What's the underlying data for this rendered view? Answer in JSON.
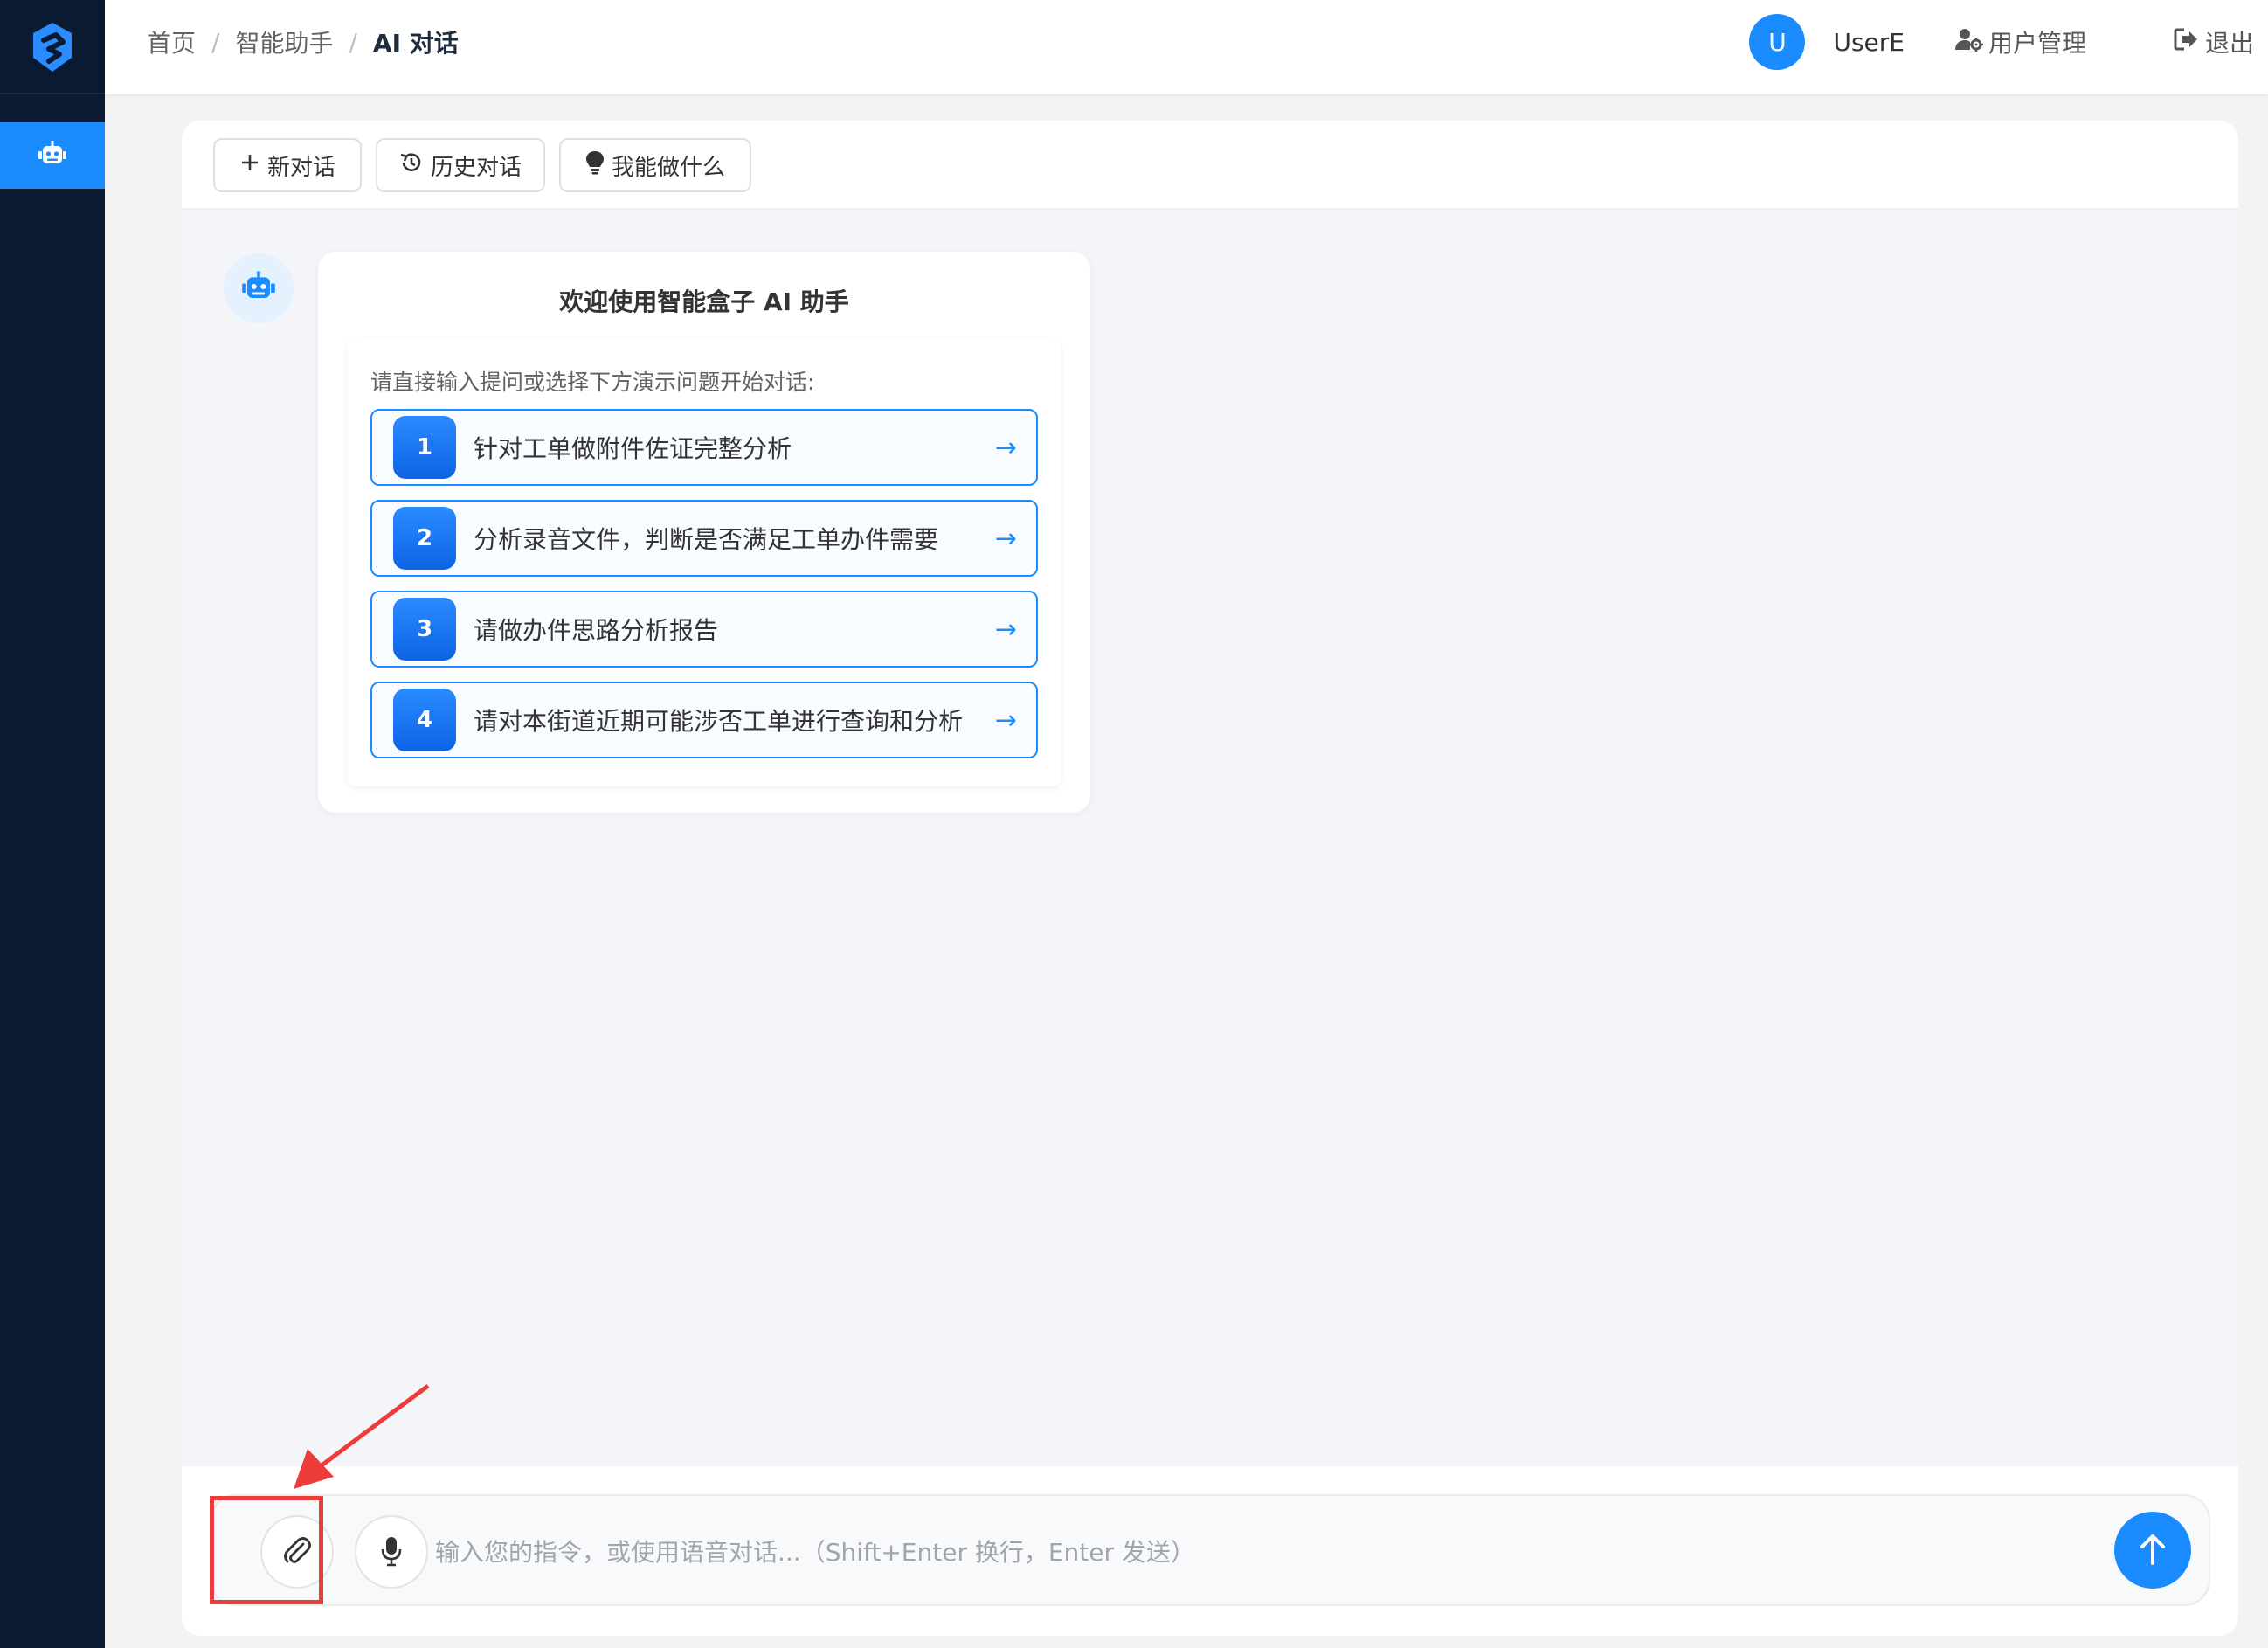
{
  "sidebar": {
    "logo_icon": "logo-shield-icon",
    "items": [
      {
        "icon": "robot-icon",
        "active": true
      }
    ]
  },
  "header": {
    "breadcrumb": [
      "首页",
      "智能助手",
      "AI 对话"
    ],
    "breadcrumb_sep": "/",
    "avatar_letter": "U",
    "username": "UserE",
    "user_mgmt_label": "用户管理",
    "logout_label": "退出"
  },
  "toolbar": {
    "new_chat": "新对话",
    "history": "历史对话",
    "capabilities": "我能做什么"
  },
  "welcome": {
    "title": "欢迎使用智能盒子 AI 助手",
    "prompt": "请直接输入提问或选择下方演示问题开始对话:",
    "questions": [
      {
        "num": "1",
        "text": "针对工单做附件佐证完整分析",
        "arrow": "→"
      },
      {
        "num": "2",
        "text": "分析录音文件，判断是否满足工单办件需要",
        "arrow": "→"
      },
      {
        "num": "3",
        "text": "请做办件思路分析报告",
        "arrow": "→"
      },
      {
        "num": "4",
        "text": "请对本街道近期可能涉否工单进行查询和分析",
        "arrow": "→"
      }
    ]
  },
  "input": {
    "placeholder": "输入您的指令，或使用语音对话...（Shift+Enter 换行，Enter 发送）",
    "value": ""
  },
  "colors": {
    "accent": "#1a8cff",
    "sidebar_bg": "#0b1a33",
    "annotation": "#ee3b3b"
  }
}
